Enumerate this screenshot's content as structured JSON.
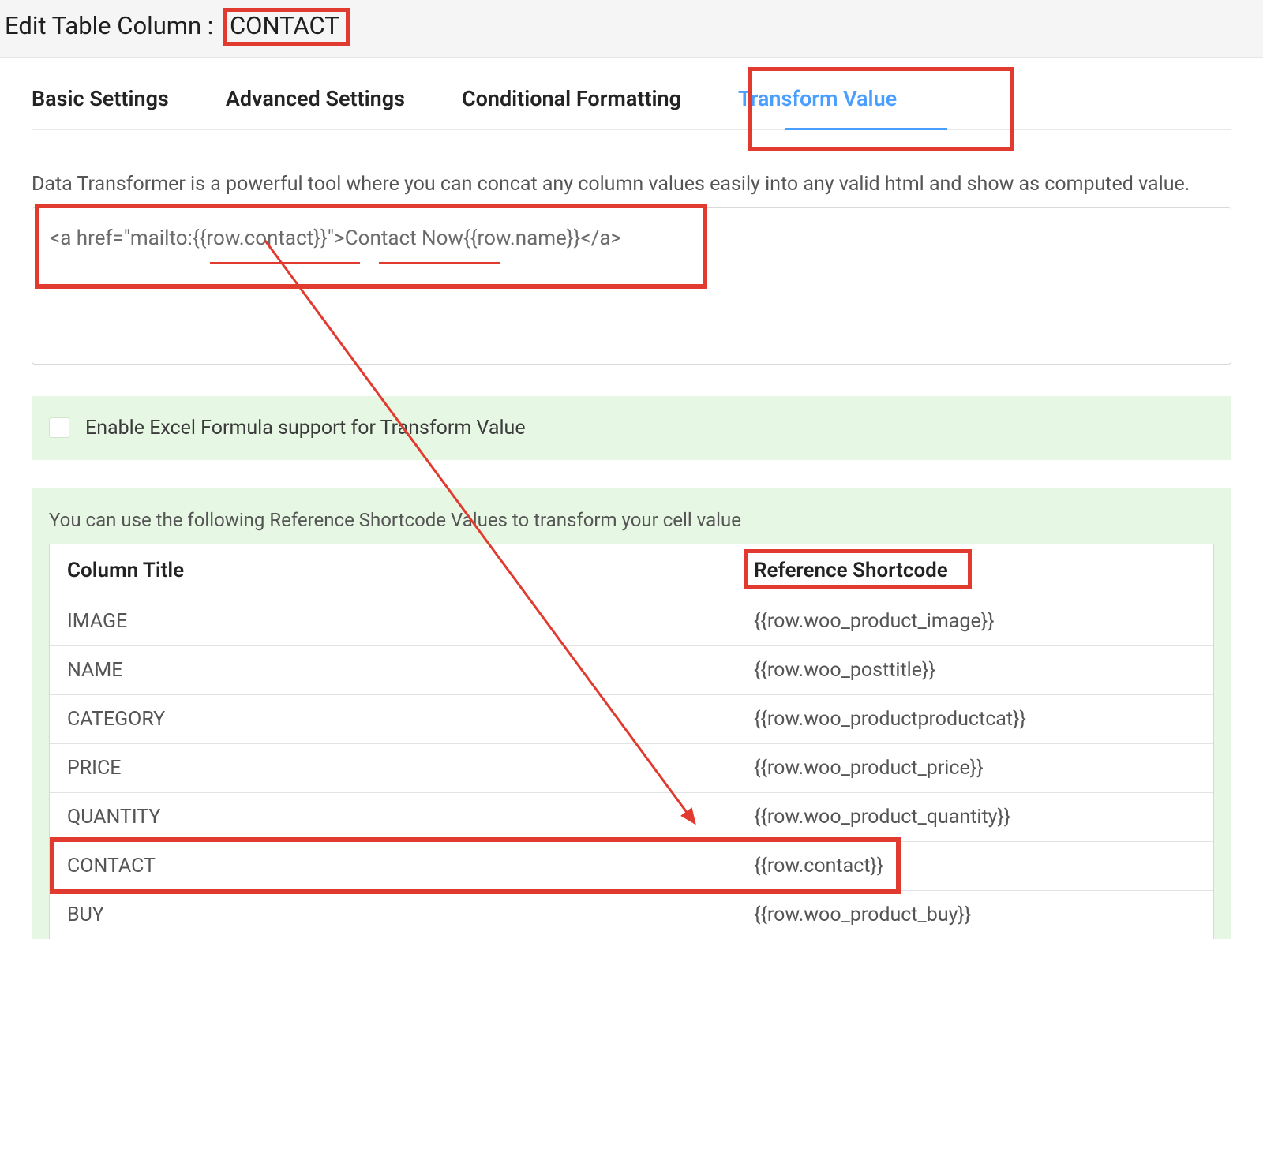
{
  "header": {
    "prefix": "Edit Table Column :",
    "column_name": "CONTACT"
  },
  "tabs": [
    {
      "label": "Basic Settings",
      "active": false
    },
    {
      "label": "Advanced Settings",
      "active": false
    },
    {
      "label": "Conditional Formatting",
      "active": false
    },
    {
      "label": "Transform Value",
      "active": true
    }
  ],
  "transform": {
    "description": "Data Transformer is a powerful tool where you can concat any column values easily into any valid html and show as computed value.",
    "code_value": "<a href=\"mailto:{{row.contact}}\">Contact Now{{row.name}}</a>",
    "excel_label": "Enable Excel Formula support for Transform Value",
    "excel_enabled": false
  },
  "reference": {
    "description": "You can use the following Reference Shortcode Values to transform your cell value",
    "col1_header": "Column Title",
    "col2_header": "Reference Shortcode",
    "rows": [
      {
        "title": "IMAGE",
        "shortcode": "{{row.woo_product_image}}"
      },
      {
        "title": "NAME",
        "shortcode": "{{row.woo_posttitle}}"
      },
      {
        "title": "CATEGORY",
        "shortcode": "{{row.woo_productproductcat}}"
      },
      {
        "title": "PRICE",
        "shortcode": "{{row.woo_product_price}}"
      },
      {
        "title": "QUANTITY",
        "shortcode": "{{row.woo_product_quantity}}"
      },
      {
        "title": "CONTACT",
        "shortcode": "{{row.contact}}"
      },
      {
        "title": "BUY",
        "shortcode": "{{row.woo_product_buy}}"
      }
    ]
  }
}
